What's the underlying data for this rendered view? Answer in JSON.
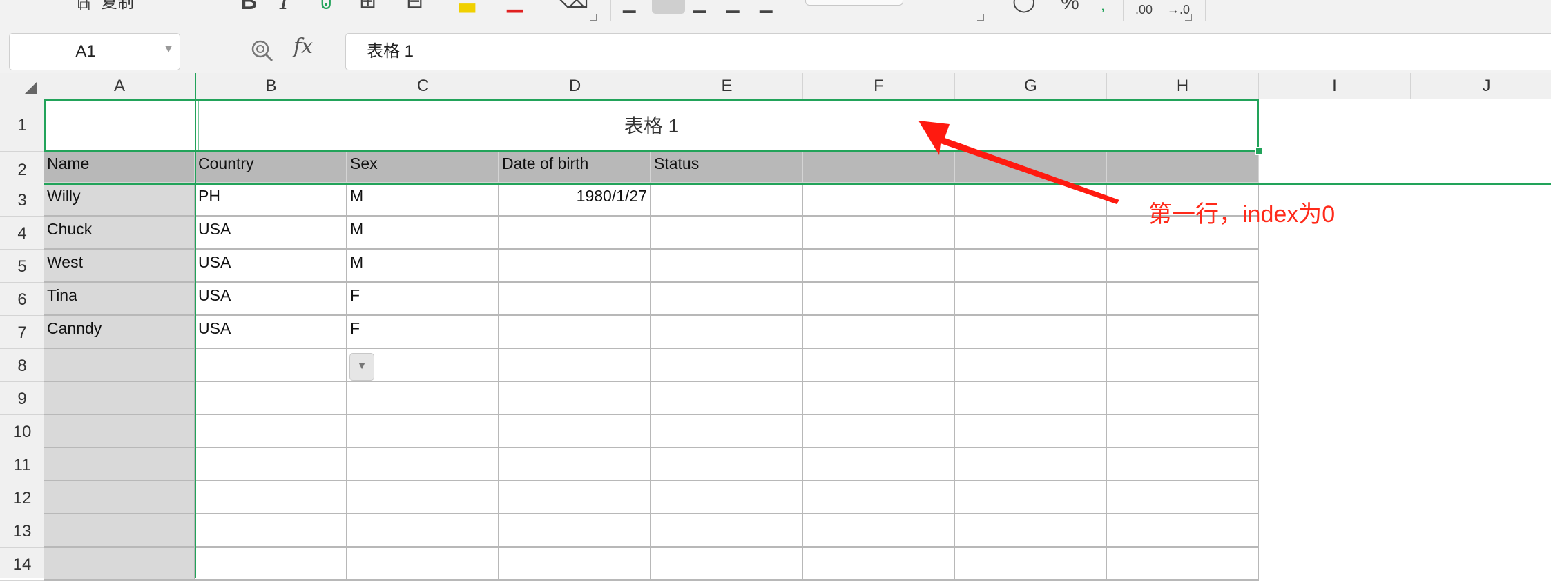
{
  "colors": {
    "selection": "#22a35a",
    "header_fill": "#b8b8b8",
    "column_a_fill": "#d9d9d9",
    "annotation": "#ff2a1a"
  },
  "toolbar": {
    "copy_icon": "copy-icon",
    "copy_label": "复制",
    "bold_label": "B",
    "italic_label": "I",
    "percent_label": "%"
  },
  "formula_bar": {
    "cell_ref": "A1",
    "fx_label": "fx",
    "content": "表格 1"
  },
  "columns": [
    "A",
    "B",
    "C",
    "D",
    "E",
    "F",
    "G",
    "H",
    "I",
    "J"
  ],
  "rows": [
    "1",
    "2",
    "3",
    "4",
    "5",
    "6",
    "7",
    "8",
    "9",
    "10",
    "11",
    "12",
    "13",
    "14"
  ],
  "sheet": {
    "title": "表格 1",
    "headers": [
      "Name",
      "Country",
      "Sex",
      "Date of birth",
      "Status"
    ],
    "records": [
      {
        "name": "Willy",
        "country": "PH",
        "sex": "M",
        "dob": "1980/1/27"
      },
      {
        "name": "Chuck",
        "country": "USA",
        "sex": "M",
        "dob": ""
      },
      {
        "name": "West",
        "country": "USA",
        "sex": "M",
        "dob": ""
      },
      {
        "name": "Tina",
        "country": "USA",
        "sex": "F",
        "dob": ""
      },
      {
        "name": "Canndy",
        "country": "USA",
        "sex": "F",
        "dob": ""
      }
    ]
  },
  "annotation": {
    "text": "第一行，index为0"
  }
}
